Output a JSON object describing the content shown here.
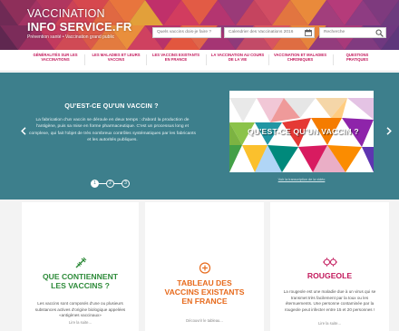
{
  "header": {
    "logo_line1": "VACCINATION",
    "logo_line2": "INFO SERVICE.FR",
    "tagline": "Prévention santé • Vaccination grand public",
    "search_vaccine_placeholder": "Quels vaccins dois-je faire ?",
    "calendar_label": "Calendrier des Vaccinations 2016",
    "search_placeholder": "Recherche",
    "calendar_icon": "calendar-icon",
    "search_icon": "search-icon"
  },
  "nav": {
    "items": [
      "GÉNÉRALITÉS SUR LES VACCINATIONS",
      "LES MALADIES ET LEURS VACCINS",
      "LES VACCINS EXISTANTS EN FRANCE",
      "LA VACCINATION AU COURS DE LA VIE",
      "VACCINATION ET MALADIES CHRONIQUES",
      "QUESTIONS PRATIQUES"
    ]
  },
  "hero": {
    "title": "QU'EST-CE QU'UN VACCIN ?",
    "text": "La fabrication d'un vaccin se déroule en deux temps : d'abord la production de l'antigène, puis sa mise en forme pharmaceutique. C'est un processus long et complexe, qui fait l'objet de très nombreux contrôles systématiques par les fabricants et les autorités publiques.",
    "video_title": "QU'EST-CE QU'UN VACCIN ?",
    "video_link": "Voir la transcription de la vidéo",
    "dots": [
      "1",
      "2",
      "3"
    ],
    "active_dot": 0,
    "prev_icon": "chevron-left-icon",
    "next_icon": "chevron-right-icon"
  },
  "cards": [
    {
      "title_line1": "QUE CONTIENNENT",
      "title_line2": "LES VACCINS ?",
      "text": "Les vaccins sont composés d'une ou plusieurs substances actives d'origine biologique appelées «antigènes vaccinaux»",
      "link": "Lire la suite...",
      "icon": "syringe-icon",
      "color": "#2e8b3a"
    },
    {
      "title_line1": "TABLEAU DES",
      "title_line2": "VACCINS EXISTANTS",
      "title_line3": "EN FRANCE",
      "text": "",
      "link": "Découvrir le tableau...",
      "icon": "plus-circle-icon",
      "color": "#e76a1c"
    },
    {
      "title_line1": "ROUGEOLE",
      "text": "La rougeole est une maladie due à un virus qui se transmet très facilement par la toux ou les éternuements. Une personne contaminée par la rougeole peut infecter entre 15 et 20 personnes !",
      "link": "Lire la suite...",
      "icon": "virus-icon",
      "color": "#c2185b"
    }
  ]
}
